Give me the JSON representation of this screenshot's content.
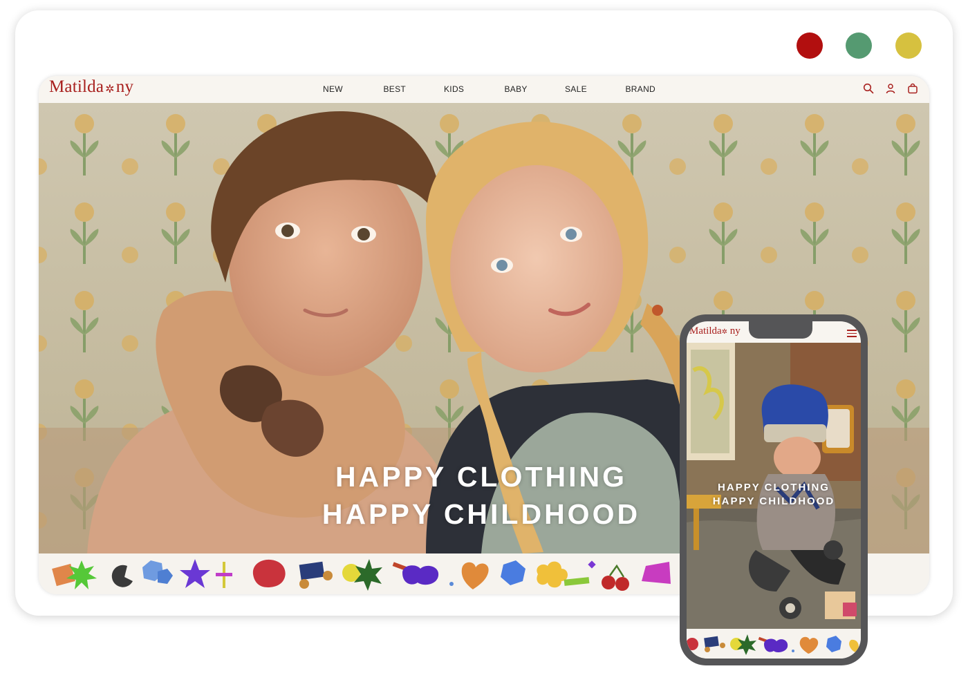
{
  "brand": {
    "name": "Matilda",
    "flower": "✲",
    "suffix": "ny",
    "color": "#a8201e"
  },
  "swatches": [
    "#b20f0f",
    "#559a71",
    "#d6c13f"
  ],
  "nav": {
    "items": [
      "NEW",
      "BEST",
      "KIDS",
      "BABY",
      "SALE",
      "BRAND"
    ]
  },
  "icons": {
    "search": "search-icon",
    "account": "user-icon",
    "cart": "shopping-bag-icon",
    "menu": "hamburger-menu-icon"
  },
  "hero": {
    "line1": "HAPPY CLOTHING",
    "line2": "HAPPY CHILDHOOD"
  },
  "mobile": {
    "line1": "HAPPY CLOTHING",
    "line2": "HAPPY CHILDHOOD"
  }
}
